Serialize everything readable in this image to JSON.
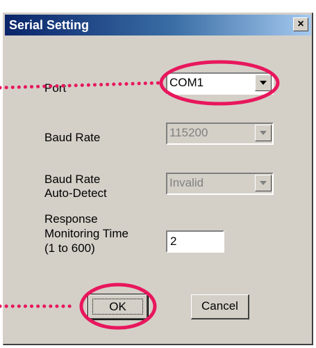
{
  "window": {
    "title": "Serial Setting",
    "close_glyph": "×"
  },
  "form": {
    "port": {
      "label": "Port",
      "value": "COM1"
    },
    "baud_rate": {
      "label": "Baud Rate",
      "value": "115200"
    },
    "auto_detect": {
      "label_line1": "Baud Rate",
      "label_line2": "Auto-Detect",
      "value": "Invalid"
    },
    "response_time": {
      "label_line1": "Response",
      "label_line2": "Monitoring Time",
      "label_line3": "(1 to 600)",
      "value": "2"
    }
  },
  "buttons": {
    "ok_label": "OK",
    "cancel_label": "Cancel"
  },
  "annotations": {
    "highlight_color": "#e8175d",
    "targets": [
      "port-combo",
      "ok-button"
    ]
  },
  "icons": {
    "close": "close-icon",
    "dropdown": "chevron-down-icon"
  }
}
